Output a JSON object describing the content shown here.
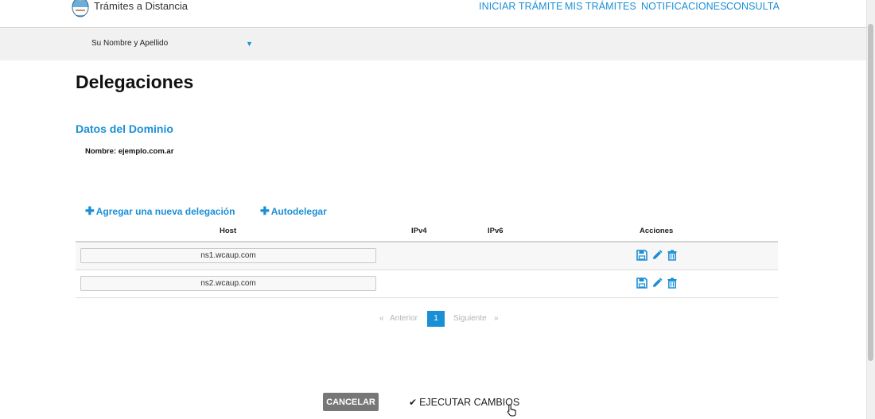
{
  "header": {
    "brand": "Trámites a Distancia",
    "nav": [
      "INICIAR TRÁMITE",
      "MIS TRÁMITES",
      "NOTIFICACIONES",
      "CONSULTA"
    ]
  },
  "userbar": {
    "name": "Su Nombre y Apellido",
    "caret_icon": "caret-down-icon"
  },
  "page": {
    "title": "Delegaciones",
    "section_title": "Datos del Dominio",
    "domain_label": "Nombre: ejemplo.com.ar"
  },
  "actions": {
    "add_label": "Agregar una nueva delegación",
    "auto_label": "Autodelegar"
  },
  "table": {
    "headers": [
      "Host",
      "IPv4",
      "IPv6",
      "Acciones"
    ],
    "rows": [
      {
        "host": "ns1.wcaup.com",
        "ipv4": "",
        "ipv6": ""
      },
      {
        "host": "ns2.wcaup.com",
        "ipv4": "",
        "ipv6": ""
      }
    ],
    "row_icons": [
      "save-icon",
      "edit-pencil-icon",
      "trash-icon"
    ]
  },
  "pagination": {
    "prev": "«",
    "prev_label": "Anterior",
    "current": "1",
    "next_label": "Siguiente",
    "next": "»"
  },
  "buttons": {
    "cancel": "CANCELAR",
    "execute": "EJECUTAR CAMBIOS"
  },
  "colors": {
    "accent": "#1a8fd6",
    "button_gray": "#777777"
  }
}
